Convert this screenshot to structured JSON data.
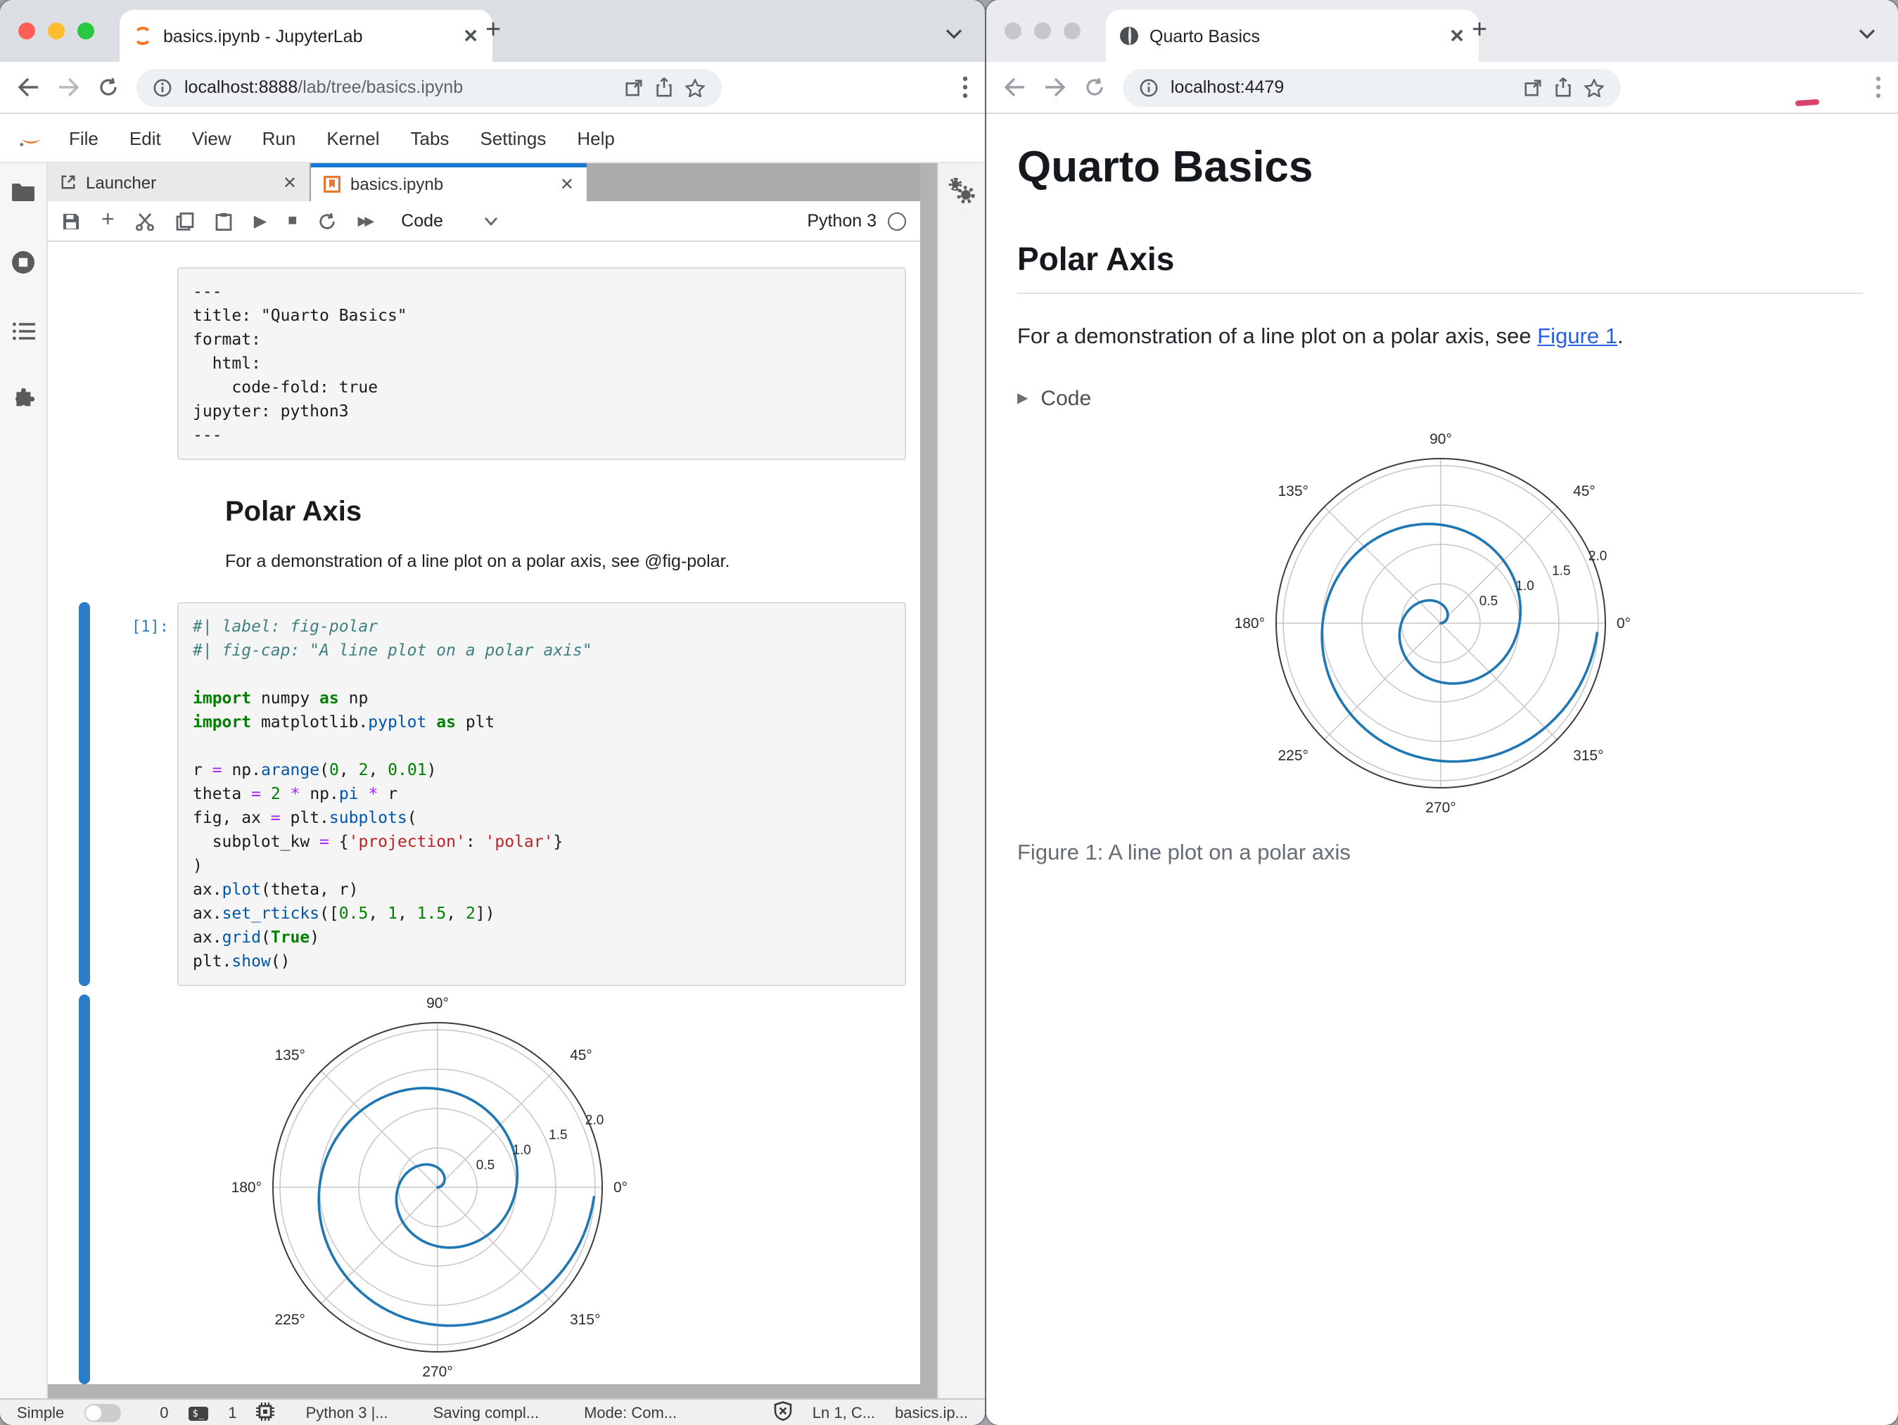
{
  "colors": {
    "traffic_close": "#ff5f57",
    "traffic_min": "#febc2e",
    "traffic_zoom": "#28c840",
    "traffic_inactive": "#c7c7c9",
    "active_tab_border": "#1976d2",
    "collapser_active": "#2b7cc9",
    "prompt_blue": "#307fc1",
    "link_blue": "#2761e3",
    "spiral_line": "#1f77b4"
  },
  "left_window": {
    "browser": {
      "tab_title": "basics.ipynb - JupyterLab",
      "url_host": "localhost:8888",
      "url_path": "/lab/tree/basics.ipynb"
    },
    "menu": [
      "File",
      "Edit",
      "View",
      "Run",
      "Kernel",
      "Tabs",
      "Settings",
      "Help"
    ],
    "dock_tabs": [
      {
        "label": "Launcher"
      },
      {
        "label": "basics.ipynb"
      }
    ],
    "toolbar": {
      "cell_type": "Code",
      "kernel_name": "Python 3"
    },
    "notebook": {
      "yaml_cell_lines": [
        "---",
        "title: \"Quarto Basics\"",
        "format:",
        "  html:",
        "    code-fold: true",
        "jupyter: python3",
        "---"
      ],
      "heading": "Polar Axis",
      "paragraph": "For a demonstration of a line plot on a polar axis, see @fig-polar.",
      "code_prompt": "[1]:",
      "code_lines": [
        [
          [
            "com",
            "#| label: fig-polar"
          ]
        ],
        [
          [
            "com",
            "#| fig-cap: \"A line plot on a polar axis\""
          ]
        ],
        [],
        [
          [
            "kw",
            "import"
          ],
          [
            "pl",
            " numpy "
          ],
          [
            "kw",
            "as"
          ],
          [
            "pl",
            " np"
          ]
        ],
        [
          [
            "kw",
            "import"
          ],
          [
            "pl",
            " matplotlib."
          ],
          [
            "prop",
            "pyplot"
          ],
          [
            "pl",
            " "
          ],
          [
            "kw",
            "as"
          ],
          [
            "pl",
            " plt"
          ]
        ],
        [],
        [
          [
            "pl",
            "r "
          ],
          [
            "op",
            "="
          ],
          [
            "pl",
            " np."
          ],
          [
            "prop",
            "arange"
          ],
          [
            "pl",
            "("
          ],
          [
            "num",
            "0"
          ],
          [
            "pl",
            ", "
          ],
          [
            "num",
            "2"
          ],
          [
            "pl",
            ", "
          ],
          [
            "num",
            "0.01"
          ],
          [
            "pl",
            ")"
          ]
        ],
        [
          [
            "pl",
            "theta "
          ],
          [
            "op",
            "="
          ],
          [
            "pl",
            " "
          ],
          [
            "num",
            "2"
          ],
          [
            "pl",
            " "
          ],
          [
            "op",
            "*"
          ],
          [
            "pl",
            " np."
          ],
          [
            "prop",
            "pi"
          ],
          [
            "pl",
            " "
          ],
          [
            "op",
            "*"
          ],
          [
            "pl",
            " r"
          ]
        ],
        [
          [
            "pl",
            "fig, ax "
          ],
          [
            "op",
            "="
          ],
          [
            "pl",
            " plt."
          ],
          [
            "prop",
            "subplots"
          ],
          [
            "pl",
            "("
          ]
        ],
        [
          [
            "pl",
            "  subplot_kw "
          ],
          [
            "op",
            "="
          ],
          [
            "pl",
            " {"
          ],
          [
            "str",
            "'projection'"
          ],
          [
            "pl",
            ": "
          ],
          [
            "str",
            "'polar'"
          ],
          [
            "pl",
            "}"
          ]
        ],
        [
          [
            "pl",
            ")"
          ]
        ],
        [
          [
            "pl",
            "ax."
          ],
          [
            "prop",
            "plot"
          ],
          [
            "pl",
            "(theta, r)"
          ]
        ],
        [
          [
            "pl",
            "ax."
          ],
          [
            "prop",
            "set_rticks"
          ],
          [
            "pl",
            "(["
          ],
          [
            "num",
            "0.5"
          ],
          [
            "pl",
            ", "
          ],
          [
            "num",
            "1"
          ],
          [
            "pl",
            ", "
          ],
          [
            "num",
            "1.5"
          ],
          [
            "pl",
            ", "
          ],
          [
            "num",
            "2"
          ],
          [
            "pl",
            "])"
          ]
        ],
        [
          [
            "pl",
            "ax."
          ],
          [
            "prop",
            "grid"
          ],
          [
            "pl",
            "("
          ],
          [
            "kw",
            "True"
          ],
          [
            "pl",
            ")"
          ]
        ],
        [
          [
            "pl",
            "plt."
          ],
          [
            "prop",
            "show"
          ],
          [
            "pl",
            "()"
          ]
        ]
      ]
    },
    "statusbar": {
      "simple_label": "Simple",
      "terminal_count": "0",
      "kernel_count": "1",
      "kernel_status": "Python 3 |...",
      "saving": "Saving compl...",
      "mode": "Mode: Com...",
      "line_col": "Ln 1, C...",
      "filename": "basics.ip..."
    }
  },
  "right_window": {
    "browser": {
      "tab_title": "Quarto Basics",
      "url_host": "localhost:4479",
      "url_path": ""
    },
    "page": {
      "title": "Quarto Basics",
      "section_heading": "Polar Axis",
      "paragraph_prefix": "For a demonstration of a line plot on a polar axis, see ",
      "link_text": "Figure 1",
      "paragraph_suffix": ".",
      "code_toggle_label": "Code",
      "figure_caption": "Figure 1: A line plot on a polar axis"
    }
  },
  "chart_data": [
    {
      "location": "jupyterlab-notebook-output",
      "type": "line",
      "projection": "polar",
      "title": "",
      "series": [
        {
          "name": "r = theta / (2*pi)",
          "r_min": 0,
          "r_max": 2,
          "r_step": 0.01,
          "theta_eq": "theta = 2 * pi * r",
          "color": "#1f77b4"
        }
      ],
      "angle_ticks": [
        {
          "deg": 0,
          "label": "0°"
        },
        {
          "deg": 45,
          "label": "45°"
        },
        {
          "deg": 90,
          "label": "90°"
        },
        {
          "deg": 135,
          "label": "135°"
        },
        {
          "deg": 180,
          "label": "180°"
        },
        {
          "deg": 225,
          "label": "225°"
        },
        {
          "deg": 270,
          "label": "270°"
        },
        {
          "deg": 315,
          "label": "315°"
        }
      ],
      "r_ticks": [
        {
          "value": 0.5,
          "label": "0.5"
        },
        {
          "value": 1,
          "label": "1.0"
        },
        {
          "value": 1.5,
          "label": "1.5"
        },
        {
          "value": 2,
          "label": "2.0"
        }
      ],
      "r_axis_max": 2.09,
      "r_label_angle_deg": 22.5,
      "grid": true
    },
    {
      "location": "quarto-preview-figure-1",
      "type": "line",
      "projection": "polar",
      "title": "",
      "series": [
        {
          "name": "r = theta / (2*pi)",
          "r_min": 0,
          "r_max": 2,
          "r_step": 0.01,
          "theta_eq": "theta = 2 * pi * r",
          "color": "#1f77b4"
        }
      ],
      "angle_ticks": [
        {
          "deg": 0,
          "label": "0°"
        },
        {
          "deg": 45,
          "label": "45°"
        },
        {
          "deg": 90,
          "label": "90°"
        },
        {
          "deg": 135,
          "label": "135°"
        },
        {
          "deg": 180,
          "label": "180°"
        },
        {
          "deg": 225,
          "label": "225°"
        },
        {
          "deg": 270,
          "label": "270°"
        },
        {
          "deg": 315,
          "label": "315°"
        }
      ],
      "r_ticks": [
        {
          "value": 0.5,
          "label": "0.5"
        },
        {
          "value": 1,
          "label": "1.0"
        },
        {
          "value": 1.5,
          "label": "1.5"
        },
        {
          "value": 2,
          "label": "2.0"
        }
      ],
      "r_axis_max": 2.09,
      "r_label_angle_deg": 22.5,
      "grid": true
    }
  ]
}
